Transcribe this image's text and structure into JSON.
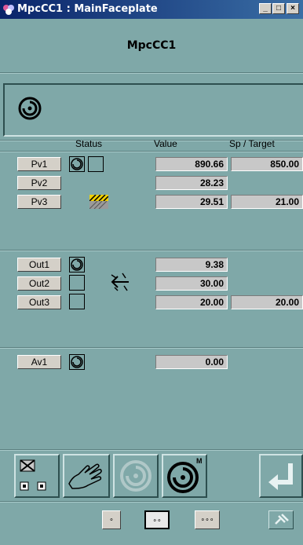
{
  "window": {
    "title": "MpcCC1 : MainFaceplate",
    "minimize_label": "_",
    "maximize_label": "□",
    "close_label": "×"
  },
  "header": {
    "name": "MpcCC1"
  },
  "columns": {
    "status": "Status",
    "value": "Value",
    "target": "Sp / Target"
  },
  "pv": [
    {
      "label": "Pv1",
      "value": "890.66",
      "target": "850.00"
    },
    {
      "label": "Pv2",
      "value": "28.23"
    },
    {
      "label": "Pv3",
      "value": "29.51",
      "target": "21.00"
    }
  ],
  "out": [
    {
      "label": "Out1",
      "value": "9.38"
    },
    {
      "label": "Out2",
      "value": "30.00"
    },
    {
      "label": "Out3",
      "value": "20.00",
      "target": "20.00"
    }
  ],
  "av": [
    {
      "label": "Av1",
      "value": "0.00"
    }
  ],
  "toolbar": {
    "mode_m_label": "M"
  },
  "selectors": {
    "one": "∘",
    "two": "∘∘",
    "three": "∘∘∘"
  },
  "colors": {
    "background": "#7fa8a8",
    "titlebar": "#0a246a",
    "button_face": "#d4d0c8",
    "value_box": "#c8c8c8"
  }
}
